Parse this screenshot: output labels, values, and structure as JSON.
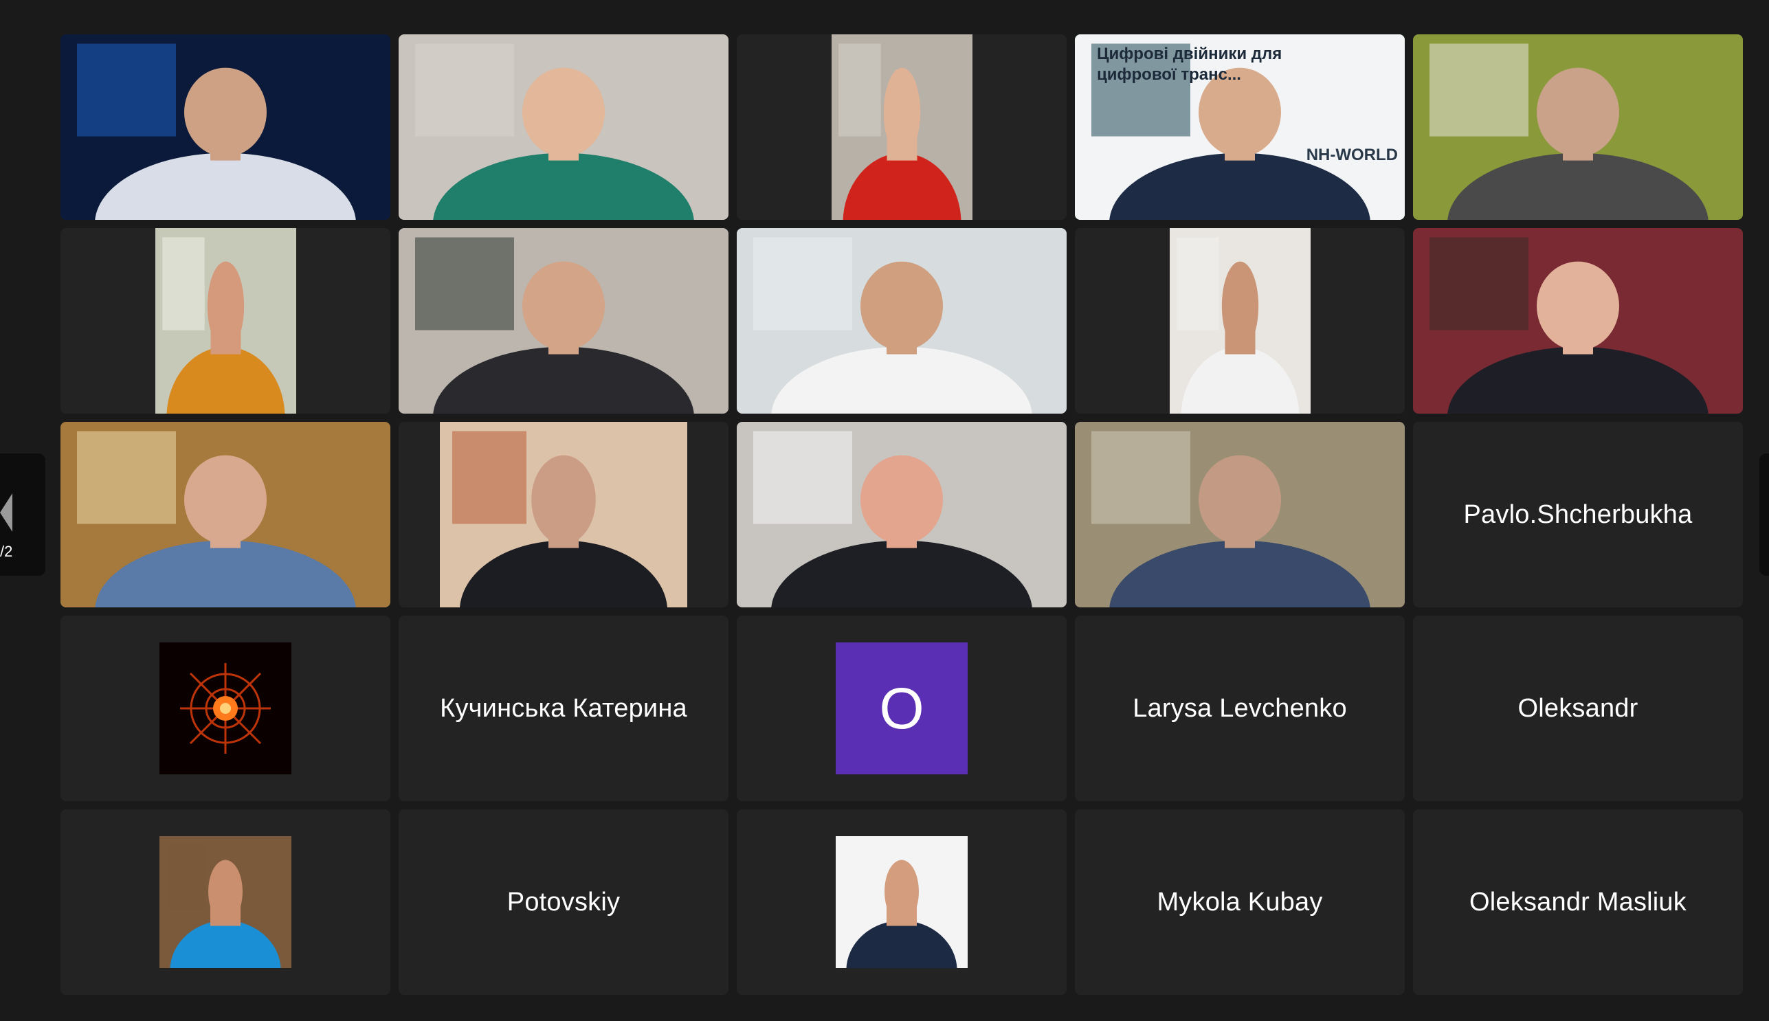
{
  "navigation": {
    "page_indicator": "/2"
  },
  "participants": [
    {
      "kind": "video",
      "bg": "#0b1a3a",
      "accent": "#1f5fbf",
      "shirt": "#d8dde8",
      "head": "#cfa184"
    },
    {
      "kind": "video",
      "bg": "#c9c4bd",
      "accent": "#d8d4ce",
      "shirt": "#1f7f6a",
      "head": "#e2b79a"
    },
    {
      "kind": "video-portrait",
      "bg": "#b8b1a8",
      "accent": "#d6d1c9",
      "shirt": "#d0231b",
      "head": "#e0b295"
    },
    {
      "kind": "video-slide",
      "bg": "#f2f4f6",
      "accent": "#244a5a",
      "shirt": "#1d2b44",
      "head": "#d9ab8d",
      "slide_line1": "Цифрові двійники для",
      "slide_line2": "цифрової транс...",
      "slide_logo": "NH-WORLD",
      "active": true
    },
    {
      "kind": "video",
      "bg": "#8a9a3a",
      "accent": "#e6e2da",
      "shirt": "#4a4a4a",
      "head": "#caa289"
    },
    {
      "kind": "video-portrait",
      "bg": "#c7c9b8",
      "accent": "#eceee6",
      "shirt": "#d98a1f",
      "head": "#d59a7c"
    },
    {
      "kind": "video",
      "bg": "#bdb6ae",
      "accent": "#2d3a34",
      "shirt": "#2a2a2e",
      "head": "#d3a488"
    },
    {
      "kind": "video",
      "bg": "#d7dcdf",
      "accent": "#eaeef0",
      "shirt": "#f3f3f3",
      "head": "#cf9f80"
    },
    {
      "kind": "video-portrait",
      "bg": "#e9e6e1",
      "accent": "#f3f1ee",
      "shirt": "#f2f2f2",
      "head": "#c99576"
    },
    {
      "kind": "video",
      "bg": "#7a2a33",
      "accent": "#3a2c24",
      "shirt": "#1e1e26",
      "head": "#e2b29a"
    },
    {
      "kind": "video",
      "bg": "#a67a3c",
      "accent": "#e9d9a8",
      "shirt": "#5a7aa8",
      "head": "#d8a98f"
    },
    {
      "kind": "video-portrait-wide",
      "bg": "#dcc2a8",
      "accent": "#b9613a",
      "shirt": "#1c1d22",
      "head": "#cc9d85"
    },
    {
      "kind": "video",
      "bg": "#c8c5c0",
      "accent": "#f4f4f4",
      "shirt": "#1d1f24",
      "head": "#e3a58e"
    },
    {
      "kind": "video",
      "bg": "#9a8f74",
      "accent": "#cfc9b8",
      "shirt": "#3a4a6a",
      "head": "#c39b84"
    },
    {
      "kind": "name",
      "name": "Pavlo.Shcherbukha"
    },
    {
      "kind": "avatar-art",
      "name": ""
    },
    {
      "kind": "name",
      "name": "Кучинська Катерина"
    },
    {
      "kind": "avatar-letter",
      "letter": "O",
      "color": "#5a2fb3"
    },
    {
      "kind": "name",
      "name": "Larysa Levchenko"
    },
    {
      "kind": "name",
      "name": "Oleksandr"
    },
    {
      "kind": "avatar-photo",
      "bg": "#7a5a3a",
      "shirt": "#1a8fd6",
      "head": "#c98f6e"
    },
    {
      "kind": "name",
      "name": "Potovskiy"
    },
    {
      "kind": "avatar-photo",
      "bg": "#f4f4f4",
      "shirt": "#1d2a44",
      "head": "#d39d7e"
    },
    {
      "kind": "name",
      "name": "Mykola Kubay"
    },
    {
      "kind": "name",
      "name": "Oleksandr Masliuk"
    }
  ]
}
